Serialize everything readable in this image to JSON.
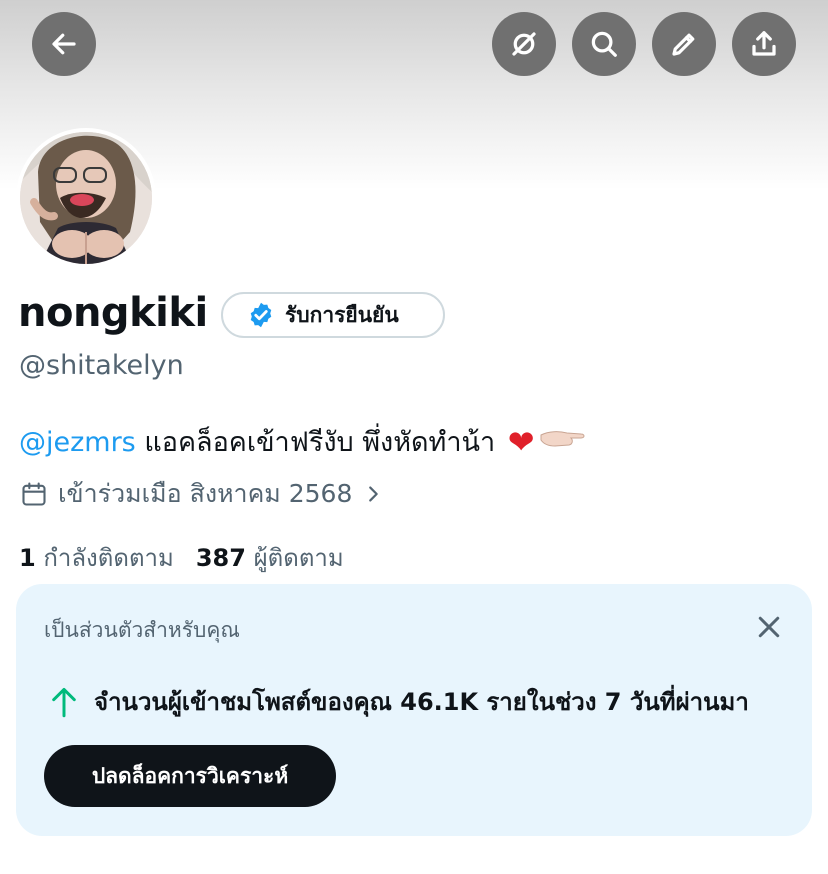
{
  "header": {
    "back_icon": "back-arrow-icon",
    "actions": [
      "hide-icon",
      "search-icon",
      "edit-icon",
      "share-icon"
    ]
  },
  "profile": {
    "display_name": "nongkiki",
    "verify_label": "รับการยืนยัน",
    "handle": "@shitakelyn",
    "bio_mention": "@jezmrs",
    "bio_text": " แอคล็อคเข้าฟรีงับ พึ่งหัดทำน้า ",
    "joined": "เข้าร่วมเมือ สิงหาคม 2568",
    "following_count": "1",
    "following_label": "กำลังติดตาม",
    "followers_count": "387",
    "followers_label": "ผู้ติดตาม"
  },
  "card": {
    "title": "เป็นส่วนตัวสำหรับคุณ",
    "stat": "จำนวนผู้เข้าชมโพสต์ของคุณ 46.1K รายในช่วง 7 วันที่ผ่านมา",
    "button": "ปลดล็อคการวิเคราะห์"
  },
  "colors": {
    "accent": "#1d9bf0",
    "secondary_text": "#536471",
    "card_bg": "#e8f5fd",
    "up_arrow": "#00ba7c"
  }
}
